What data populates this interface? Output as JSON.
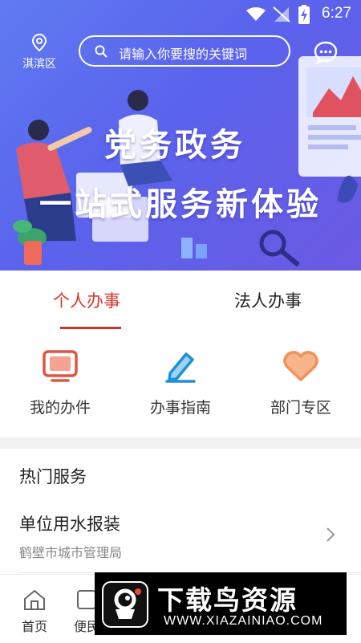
{
  "status_bar": {
    "time": "6:27"
  },
  "header": {
    "location": "淇滨区",
    "search_placeholder": "请输入你要搜的关键词"
  },
  "banner": {
    "line1": "党务政务",
    "line2": "一站式服务新体验"
  },
  "tabs": [
    {
      "label": "个人办事",
      "active": true
    },
    {
      "label": "法人办事",
      "active": false
    }
  ],
  "shortcuts": [
    {
      "label": "我的办件",
      "icon": "monitor-icon"
    },
    {
      "label": "办事指南",
      "icon": "pencil-icon"
    },
    {
      "label": "部门专区",
      "icon": "heart-icon"
    }
  ],
  "hot_services": {
    "title": "热门服务",
    "items": [
      {
        "title": "单位用水报装",
        "subtitle": "鹤壁市城市管理局"
      }
    ]
  },
  "bottom_nav": [
    {
      "label": "首页",
      "icon": "home-icon"
    },
    {
      "label": "便民",
      "icon": "convenience-icon"
    }
  ],
  "watermark": {
    "title": "下载鸟资源",
    "url": "WWW.XIAZAINIAO.COM"
  },
  "colors": {
    "accent": "#d9362b",
    "banner_start": "#5f7bf2",
    "banner_end": "#6b59e3",
    "icon_red": "#e2543f",
    "icon_blue": "#1f8fd6",
    "icon_orange": "#f0925a"
  }
}
